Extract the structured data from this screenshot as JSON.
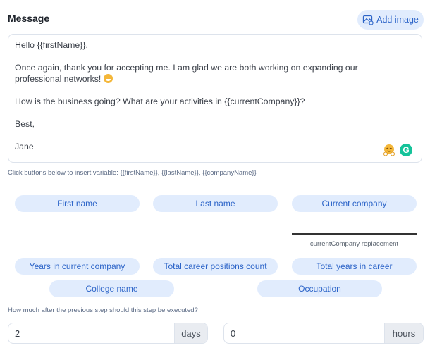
{
  "header": {
    "title": "Message",
    "add_image_label": "Add image"
  },
  "message": {
    "lines": [
      "Hello {{firstName}},",
      "Once again, thank you for accepting me. I am glad we are both working on expanding our",
      "professional networks!",
      "How is the business going? What are your activities in {{currentCompany}}?",
      "Best,",
      "Jane"
    ],
    "emoji": "grinning-face"
  },
  "hint": "Click buttons below to insert variable: {{firstName}}, {{lastName}}, {{companyName}}",
  "variables": [
    "First name",
    "Last name",
    "Current company",
    "Years in current company",
    "Total career positions count",
    "Total years in career",
    "College name",
    "Occupation"
  ],
  "replacement": {
    "label": "currentCompany replacement",
    "value": ""
  },
  "delay": {
    "question": "How much after the previous step should this step be executed?",
    "days_value": "2",
    "days_unit": "days",
    "hours_value": "0",
    "hours_unit": "hours"
  }
}
